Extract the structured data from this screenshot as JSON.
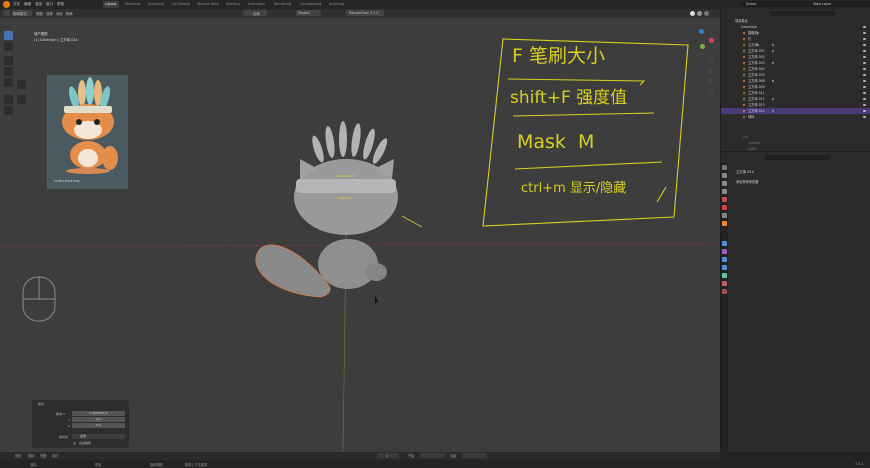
{
  "menus": [
    "文件",
    "编辑",
    "渲染",
    "窗口",
    "帮助"
  ],
  "workspaces": [
    {
      "label": "Layout",
      "active": true
    },
    {
      "label": "Modeling",
      "active": false
    },
    {
      "label": "Sculpting",
      "active": false
    },
    {
      "label": "UV Editing",
      "active": false
    },
    {
      "label": "Texture Paint",
      "active": false
    },
    {
      "label": "Shading",
      "active": false
    },
    {
      "label": "Animation",
      "active": false
    },
    {
      "label": "Rendering",
      "active": false
    },
    {
      "label": "Compositing",
      "active": false
    },
    {
      "label": "Scripting",
      "active": false
    }
  ],
  "scene": {
    "label": "Scene",
    "view_layer": "View Layer"
  },
  "viewport_header": {
    "mode": "物体模式",
    "view": "视图",
    "select": "选择",
    "add": "添加",
    "object": "物体",
    "transform": "全局",
    "addon_a": "Models",
    "addon_b": "RetopoFlow 3.1.0"
  },
  "viewport": {
    "info_line1": "用户透视",
    "info_line2": "(1) Collection | 立方体.014"
  },
  "notes": {
    "line1": "F 笔刷大小",
    "line2": "shift+F 强度值",
    "line3": "Mask  M",
    "line4": "ctrl+m 显示/隐藏"
  },
  "ref_image": {
    "caption": "CUTE LITTLE FOX"
  },
  "outliner": {
    "title": "场景集合",
    "collection": "Collection",
    "items": [
      {
        "name": "摄像机",
        "selected": false
      },
      {
        "name": "灯",
        "selected": false
      },
      {
        "name": "立方体",
        "selected": false
      },
      {
        "name": "立方体.001",
        "selected": false
      },
      {
        "name": "立方体.002",
        "selected": false
      },
      {
        "name": "立方体.003",
        "selected": false
      },
      {
        "name": "立方体.004",
        "selected": false
      },
      {
        "name": "立方体.005",
        "selected": false
      },
      {
        "name": "立方体.008",
        "selected": false
      },
      {
        "name": "立方体.009",
        "selected": false
      },
      {
        "name": "立方体.011",
        "selected": false
      },
      {
        "name": "立方体.012",
        "selected": false
      },
      {
        "name": "立方体.013",
        "selected": false
      },
      {
        "name": "立方体.014",
        "selected": true
      },
      {
        "name": "球体",
        "selected": false
      }
    ],
    "sub_collection": "Col",
    "camera": "Camera",
    "light": "Light"
  },
  "properties": {
    "object_name": "立方体.014",
    "section": "添加物体修改器"
  },
  "adjust_panel": {
    "title": "移动",
    "move_x_label": "移动 X",
    "move_x": "0.000236 m",
    "y_label": "Y",
    "y": "0 m",
    "z_label": "Z",
    "z": "0 m",
    "orient_label": "坐标系",
    "orient": "全局",
    "proportional": "衰减编辑"
  },
  "status": {
    "select": "选择",
    "box_select": "框选",
    "rotate": "旋转视图",
    "context": "物体上下文菜单",
    "version": "3.4.1"
  },
  "timeline": {
    "playback": "回放",
    "keying": "插帧",
    "view": "视图",
    "marker": "标记",
    "start": "开始",
    "end": "结束",
    "frame": "1"
  }
}
